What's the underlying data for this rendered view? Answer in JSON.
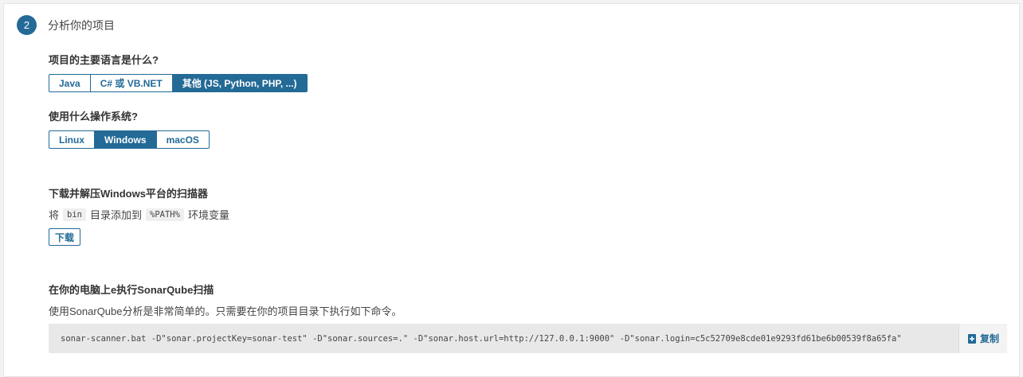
{
  "step": {
    "number": "2",
    "title": "分析你的项目"
  },
  "language": {
    "question": "项目的主要语言是什么?",
    "options": [
      "Java",
      "C# 或 VB.NET",
      "其他 (JS, Python, PHP, ...)"
    ],
    "selected": "其他 (JS, Python, PHP, ...)"
  },
  "os": {
    "question": "使用什么操作系统?",
    "options": [
      "Linux",
      "Windows",
      "macOS"
    ],
    "selected": "Windows"
  },
  "download": {
    "title": "下载并解压Windows平台的扫描器",
    "desc_prefix": "将",
    "chip_bin": "bin",
    "desc_middle": "目录添加到",
    "chip_path": "%PATH%",
    "desc_suffix": "环境变量",
    "button_label": "下载"
  },
  "execute": {
    "title": "在你的电脑上e执行SonarQube扫描",
    "desc": "使用SonarQube分析是非常简单的。只需要在你的项目目录下执行如下命令。",
    "command": "sonar-scanner.bat -D\"sonar.projectKey=sonar-test\" -D\"sonar.sources=.\" -D\"sonar.host.url=http://127.0.0.1:9000\" -D\"sonar.login=c5c52709e8cde01e9293fd61be6b00539f8a65fa\"",
    "copy_label": "复制",
    "copy_icon": "copy-icon"
  },
  "colors": {
    "accent": "#236a97",
    "code_bg": "#e8e8e8"
  }
}
